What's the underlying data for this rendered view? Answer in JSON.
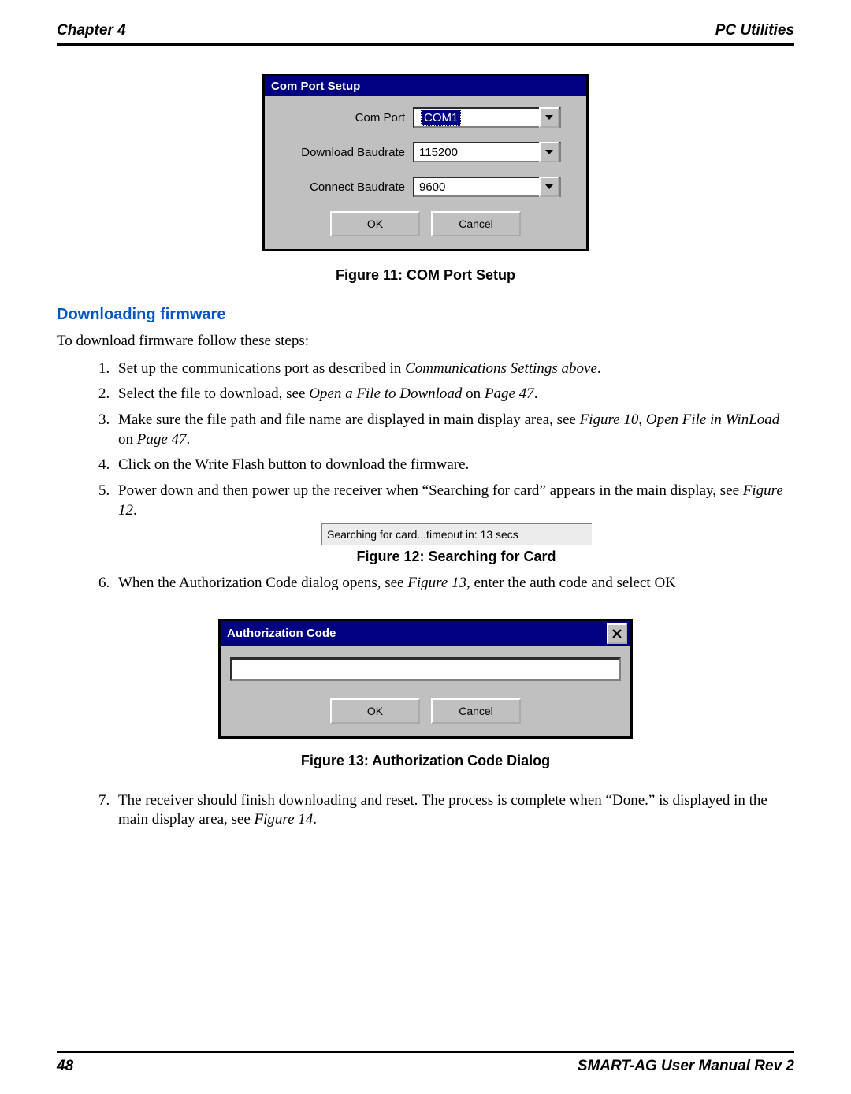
{
  "header": {
    "left": "Chapter 4",
    "right": "PC Utilities"
  },
  "dialog_comport": {
    "title": "Com Port Setup",
    "rows": {
      "comport": {
        "label": "Com Port",
        "value": "COM1"
      },
      "dl": {
        "label": "Download Baudrate",
        "value": "115200"
      },
      "conn": {
        "label": "Connect Baudrate",
        "value": "9600"
      }
    },
    "buttons": {
      "ok": "OK",
      "cancel": "Cancel"
    }
  },
  "figure11": "Figure 11: COM Port Setup",
  "section_heading": "Downloading firmware",
  "intro": "To download firmware follow these steps:",
  "steps": {
    "s1a": "Set up the communications port as described in ",
    "s1b": "Communications Settings above",
    "s1c": ".",
    "s2a": "Select the file to download, see ",
    "s2b": "Open a File to Download",
    "s2c": " on ",
    "s2d": "Page 47",
    "s2e": ".",
    "s3a": "Make sure the file path and file name are displayed in main display area, see ",
    "s3b": "Figure 10, Open File in WinLoad",
    "s3c": " on ",
    "s3d": "Page 47",
    "s3e": ".",
    "s4": "Click on the Write Flash button to download the firmware.",
    "s5a": "Power down and then power up the receiver when “Searching for card” appears in the main display, see ",
    "s5b": "Figure 12",
    "s5c": ".",
    "s6a": "When the Authorization Code dialog opens, see ",
    "s6b": "Figure 13",
    "s6c": ", enter the auth code and select OK",
    "s7a": "The receiver should finish downloading and reset. The process is complete when “Done.” is displayed in the main display area, see ",
    "s7b": "Figure 14",
    "s7c": "."
  },
  "searching_text": "Searching for card...timeout in: 13 secs",
  "figure12": "Figure 12: Searching for Card",
  "dialog_auth": {
    "title": "Authorization Code",
    "buttons": {
      "ok": "OK",
      "cancel": "Cancel"
    }
  },
  "figure13": "Figure 13: Authorization Code Dialog",
  "footer": {
    "page": "48",
    "manual": "SMART-AG User Manual Rev 2"
  }
}
